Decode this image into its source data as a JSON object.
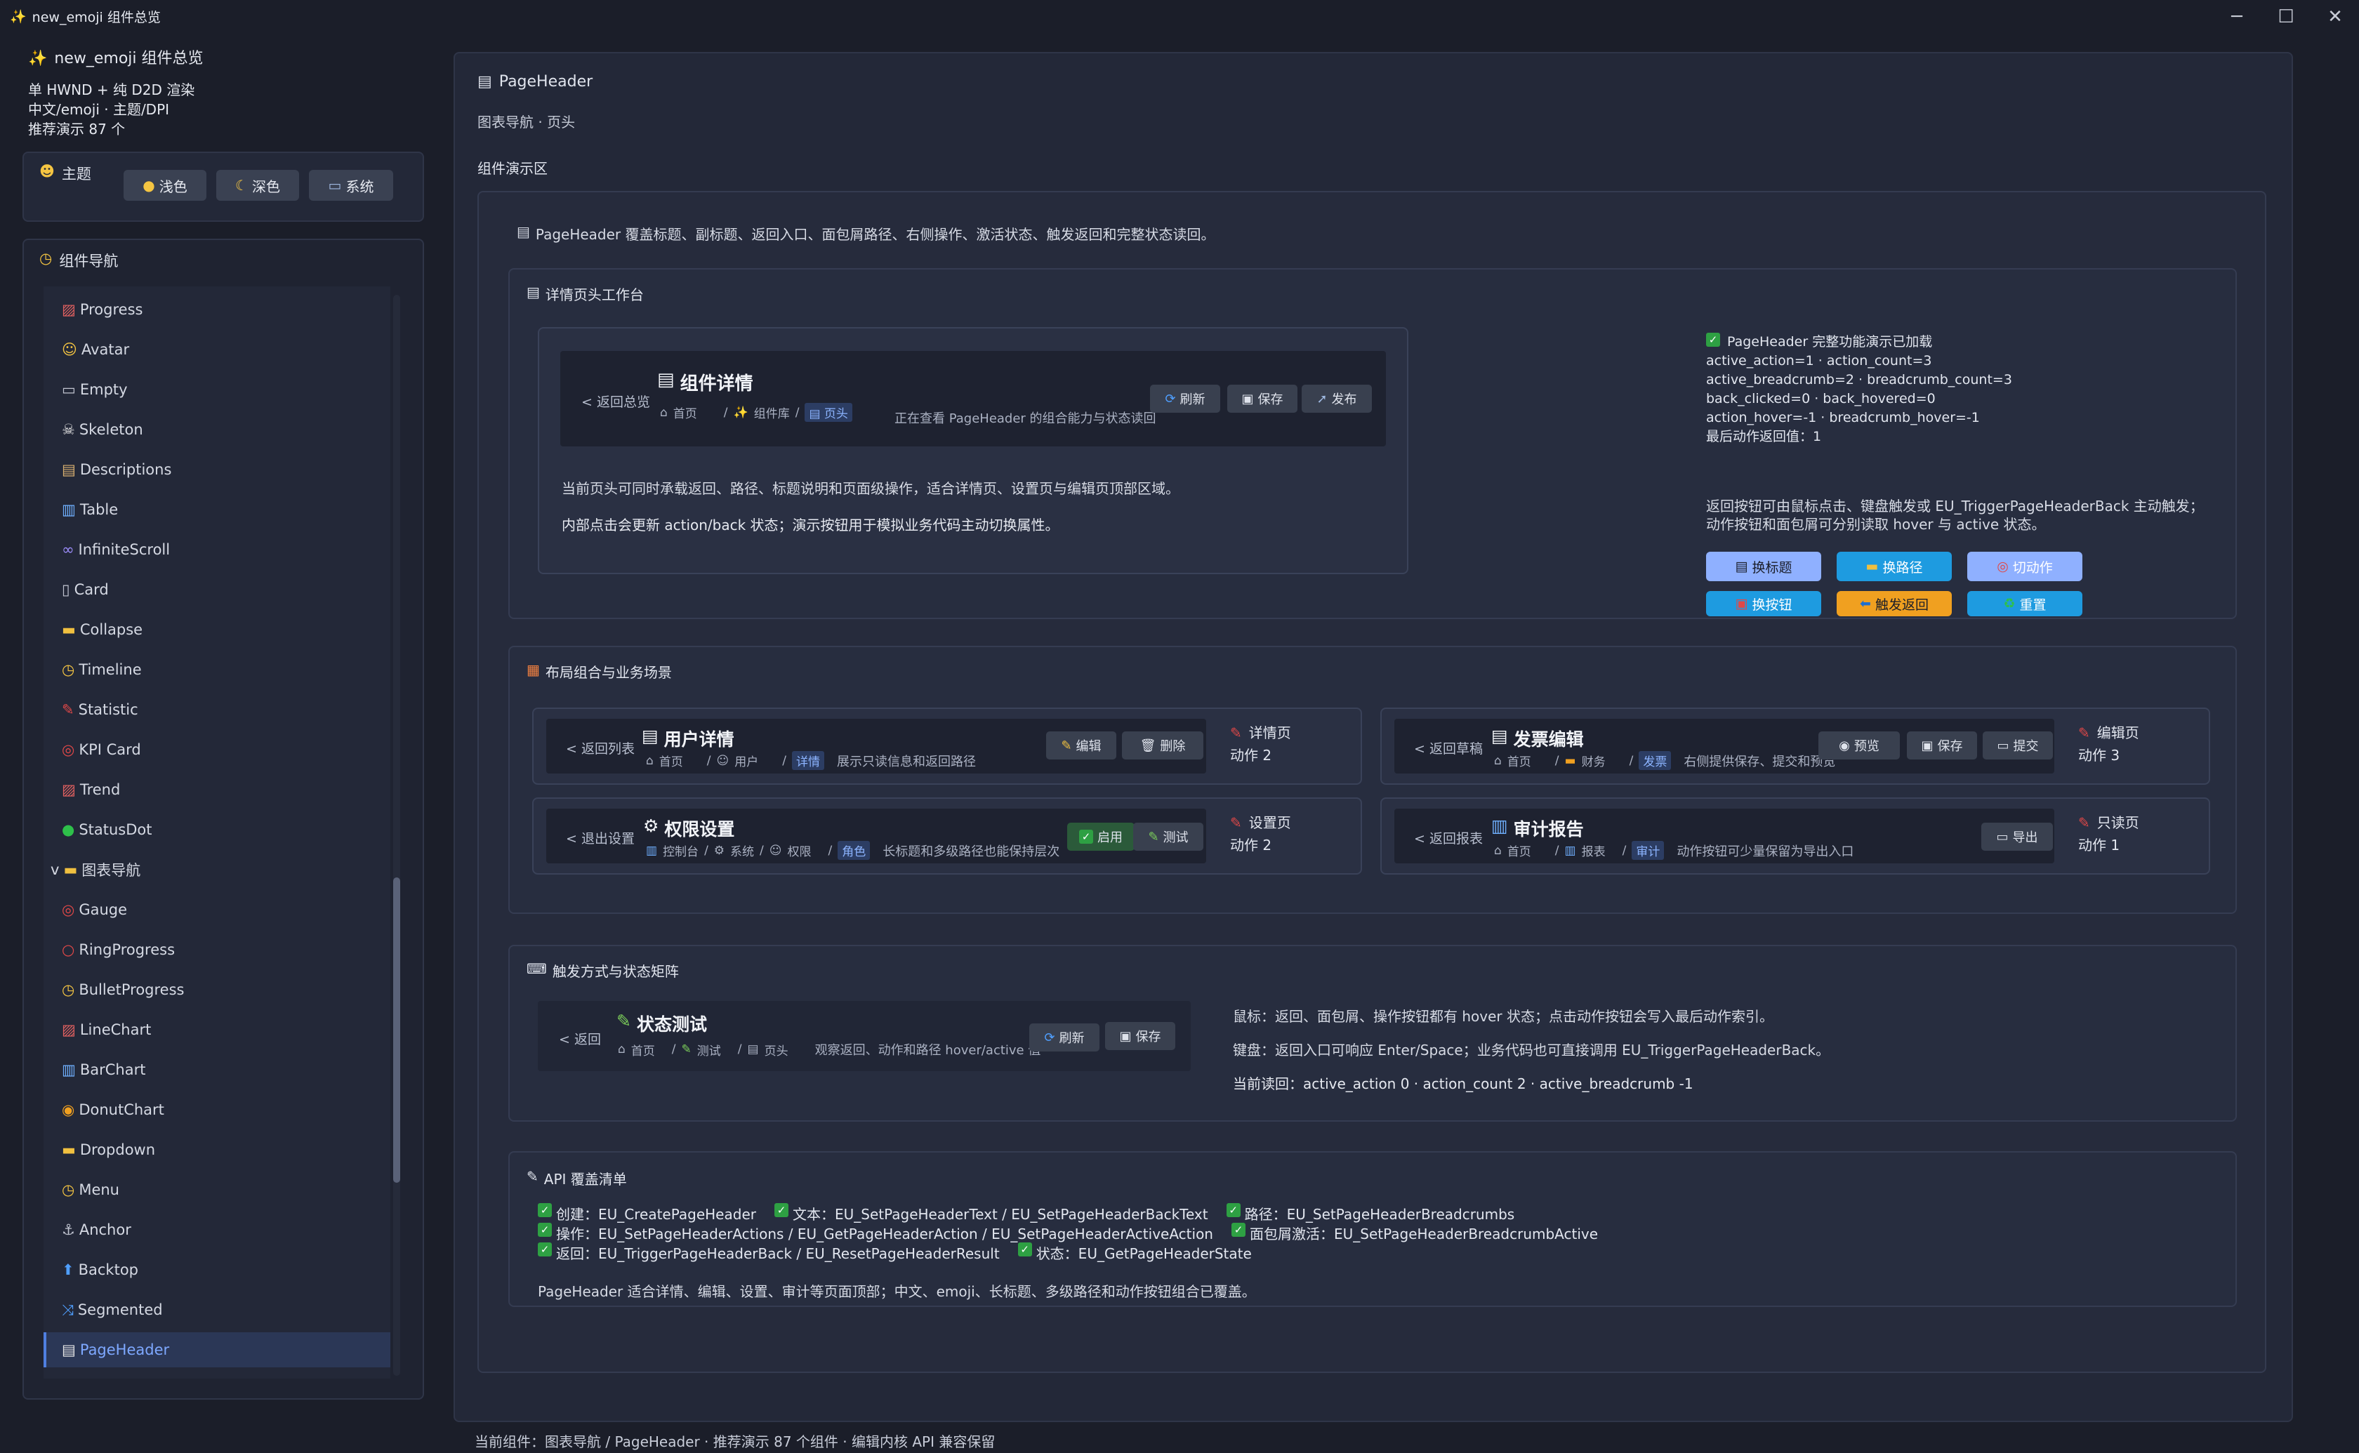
{
  "window": {
    "title": "new_emoji 组件总览",
    "icon": "✨"
  },
  "sidebar": {
    "app_title": "new_emoji 组件总览",
    "info1": "单 HWND + 纯 D2D 渲染",
    "info2": "中文/emoji · 主题/DPI",
    "info3": "推荐演示 87 个",
    "theme_label": "主题",
    "theme_buttons": [
      "浅色",
      "深色",
      "系统"
    ],
    "nav_label": "组件导航",
    "nav_items": [
      "Progress",
      "Avatar",
      "Empty",
      "Skeleton",
      "Descriptions",
      "Table",
      "InfiniteScroll",
      "Card",
      "Collapse",
      "Timeline",
      "Statistic",
      "KPI Card",
      "Trend",
      "StatusDot",
      "图表导航",
      "Gauge",
      "RingProgress",
      "BulletProgress",
      "LineChart",
      "BarChart",
      "DonutChart",
      "Dropdown",
      "Menu",
      "Anchor",
      "Backtop",
      "Segmented",
      "PageHeader"
    ]
  },
  "main": {
    "title": "PageHeader",
    "subtitle": "图表导航 · 页头",
    "demo_label": "组件演示区",
    "intro": "PageHeader 覆盖标题、副标题、返回入口、面包屑路径、右侧操作、激活状态、触发返回和完整状态读回。",
    "workbench": {
      "title": "详情页头工作台",
      "back": "< 返回总览",
      "ph_title": "组件详情",
      "crumbs": [
        "首页",
        "组件库",
        "页头"
      ],
      "subtitle": "正在查看 PageHeader 的组合能力与状态读回",
      "actions": [
        "刷新",
        "保存",
        "发布"
      ],
      "text1": "当前页头可同时承载返回、路径、标题说明和页面级操作，适合详情页、设置页与编辑页顶部区域。",
      "text2": "内部点击会更新 action/back 状态；演示按钮用于模拟业务代码主动切换属性。",
      "status_title": "PageHeader 完整功能演示已加载",
      "status_lines": [
        "active_action=1 · action_count=3",
        "active_breadcrumb=2 · breadcrumb_count=3",
        "back_clicked=0 · back_hovered=0",
        "action_hover=-1 · breadcrumb_hover=-1",
        "最后动作返回值：1"
      ],
      "hint1": "返回按钮可由鼠标点击、键盘触发或 EU_TriggerPageHeaderBack 主动触发；",
      "hint2": "动作按钮和面包屑可分别读取 hover 与 active 状态。",
      "pills": [
        "换标题",
        "换路径",
        "切动作",
        "换按钮",
        "触发返回",
        "重置"
      ]
    },
    "layouts": {
      "title": "布局组合与业务场景",
      "cards": [
        {
          "back": "< 返回列表",
          "title": "用户详情",
          "crumbs": [
            "首页",
            "用户",
            "详情"
          ],
          "sub": "展示只读信息和返回路径",
          "actions": [
            "编辑",
            "删除"
          ],
          "kind": "详情页",
          "count": "动作 2"
        },
        {
          "back": "< 返回草稿",
          "title": "发票编辑",
          "crumbs": [
            "首页",
            "财务",
            "发票"
          ],
          "sub": "右侧提供保存、提交和预览",
          "actions": [
            "预览",
            "保存",
            "提交"
          ],
          "kind": "编辑页",
          "count": "动作 3"
        },
        {
          "back": "< 退出设置",
          "title": "权限设置",
          "crumbs": [
            "控制台",
            "系统",
            "权限",
            "角色"
          ],
          "sub": "长标题和多级路径也能保持层次",
          "actions": [
            "启用",
            "测试"
          ],
          "kind": "设置页",
          "count": "动作 2"
        },
        {
          "back": "< 返回报表",
          "title": "审计报告",
          "crumbs": [
            "首页",
            "报表",
            "审计"
          ],
          "sub": "动作按钮可少量保留为导出入口",
          "actions": [
            "导出"
          ],
          "kind": "只读页",
          "count": "动作 1"
        }
      ]
    },
    "triggers": {
      "title": "触发方式与状态矩阵",
      "back": "< 返回",
      "ph_title": "状态测试",
      "crumbs": [
        "首页",
        "测试",
        "页头"
      ],
      "sub": "观察返回、动作和路径 hover/active 值",
      "actions": [
        "刷新",
        "保存"
      ],
      "line1": "鼠标：返回、面包屑、操作按钮都有 hover 状态；点击动作按钮会写入最后动作索引。",
      "line2": "键盘：返回入口可响应 Enter/Space；业务代码也可直接调用 EU_TriggerPageHeaderBack。",
      "line3": "当前读回：active_action 0 · action_count 2 · active_breadcrumb -1"
    },
    "api": {
      "title": "API 覆盖清单",
      "row1": [
        "创建：EU_CreatePageHeader",
        "文本：EU_SetPageHeaderText / EU_SetPageHeaderBackText",
        "路径：EU_SetPageHeaderBreadcrumbs"
      ],
      "row2": [
        "操作：EU_SetPageHeaderActions / EU_GetPageHeaderAction / EU_SetPageHeaderActiveAction",
        "面包屑激活：EU_SetPageHeaderBreadcrumbActive"
      ],
      "row3": [
        "返回：EU_TriggerPageHeaderBack / EU_ResetPageHeaderResult",
        "状态：EU_GetPageHeaderState"
      ],
      "summary": "PageHeader 适合详情、编辑、设置、审计等页面顶部；中文、emoji、长标题、多级路径和动作按钮组合已覆盖。"
    }
  },
  "footer": "当前组件：图表导航 / PageHeader · 推荐演示 87 个组件 · 编辑内核 API 兼容保留",
  "colors": {
    "accent": "#4f7fe0",
    "pill_light": "#7ea8ff",
    "pill_blue": "#1e9be0",
    "pill_orange": "#f0a020"
  }
}
